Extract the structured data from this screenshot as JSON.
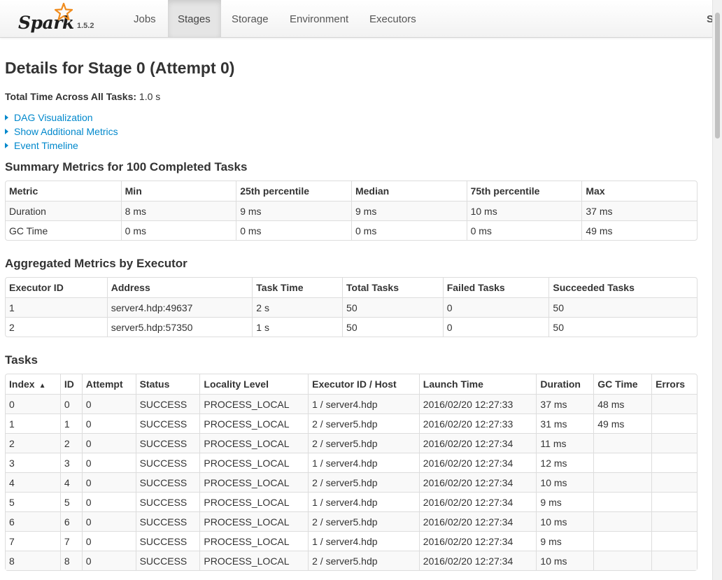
{
  "brand": {
    "name": "Spark",
    "version": "1.5.2"
  },
  "nav": {
    "tabs": [
      {
        "label": "Jobs"
      },
      {
        "label": "Stages"
      },
      {
        "label": "Storage"
      },
      {
        "label": "Environment"
      },
      {
        "label": "Executors"
      }
    ],
    "active": "Stages",
    "cut_tab": "S"
  },
  "page": {
    "title": "Details for Stage 0 (Attempt 0)",
    "total_time_label": "Total Time Across All Tasks:",
    "total_time_value": "1.0 s",
    "expanders": [
      "DAG Visualization",
      "Show Additional Metrics",
      "Event Timeline"
    ]
  },
  "summary": {
    "heading": "Summary Metrics for 100 Completed Tasks",
    "headers": [
      "Metric",
      "Min",
      "25th percentile",
      "Median",
      "75th percentile",
      "Max"
    ],
    "rows": [
      [
        "Duration",
        "8 ms",
        "9 ms",
        "9 ms",
        "10 ms",
        "37 ms"
      ],
      [
        "GC Time",
        "0 ms",
        "0 ms",
        "0 ms",
        "0 ms",
        "49 ms"
      ]
    ]
  },
  "executors": {
    "heading": "Aggregated Metrics by Executor",
    "headers": [
      "Executor ID",
      "Address",
      "Task Time",
      "Total Tasks",
      "Failed Tasks",
      "Succeeded Tasks"
    ],
    "rows": [
      [
        "1",
        "server4.hdp:49637",
        "2 s",
        "50",
        "0",
        "50"
      ],
      [
        "2",
        "server5.hdp:57350",
        "1 s",
        "50",
        "0",
        "50"
      ]
    ]
  },
  "tasks": {
    "heading": "Tasks",
    "headers": [
      "Index",
      "ID",
      "Attempt",
      "Status",
      "Locality Level",
      "Executor ID / Host",
      "Launch Time",
      "Duration",
      "GC Time",
      "Errors"
    ],
    "sort_indicator": "▲",
    "rows": [
      [
        "0",
        "0",
        "0",
        "SUCCESS",
        "PROCESS_LOCAL",
        "1 / server4.hdp",
        "2016/02/20 12:27:33",
        "37 ms",
        "48 ms",
        ""
      ],
      [
        "1",
        "1",
        "0",
        "SUCCESS",
        "PROCESS_LOCAL",
        "2 / server5.hdp",
        "2016/02/20 12:27:33",
        "31 ms",
        "49 ms",
        ""
      ],
      [
        "2",
        "2",
        "0",
        "SUCCESS",
        "PROCESS_LOCAL",
        "2 / server5.hdp",
        "2016/02/20 12:27:34",
        "11 ms",
        "",
        ""
      ],
      [
        "3",
        "3",
        "0",
        "SUCCESS",
        "PROCESS_LOCAL",
        "1 / server4.hdp",
        "2016/02/20 12:27:34",
        "12 ms",
        "",
        ""
      ],
      [
        "4",
        "4",
        "0",
        "SUCCESS",
        "PROCESS_LOCAL",
        "2 / server5.hdp",
        "2016/02/20 12:27:34",
        "10 ms",
        "",
        ""
      ],
      [
        "5",
        "5",
        "0",
        "SUCCESS",
        "PROCESS_LOCAL",
        "1 / server4.hdp",
        "2016/02/20 12:27:34",
        "9 ms",
        "",
        ""
      ],
      [
        "6",
        "6",
        "0",
        "SUCCESS",
        "PROCESS_LOCAL",
        "2 / server5.hdp",
        "2016/02/20 12:27:34",
        "10 ms",
        "",
        ""
      ],
      [
        "7",
        "7",
        "0",
        "SUCCESS",
        "PROCESS_LOCAL",
        "1 / server4.hdp",
        "2016/02/20 12:27:34",
        "9 ms",
        "",
        ""
      ],
      [
        "8",
        "8",
        "0",
        "SUCCESS",
        "PROCESS_LOCAL",
        "2 / server5.hdp",
        "2016/02/20 12:27:34",
        "10 ms",
        "",
        ""
      ]
    ]
  },
  "colors": {
    "link": "#0088cc",
    "brand_star": "#f08c1e"
  }
}
